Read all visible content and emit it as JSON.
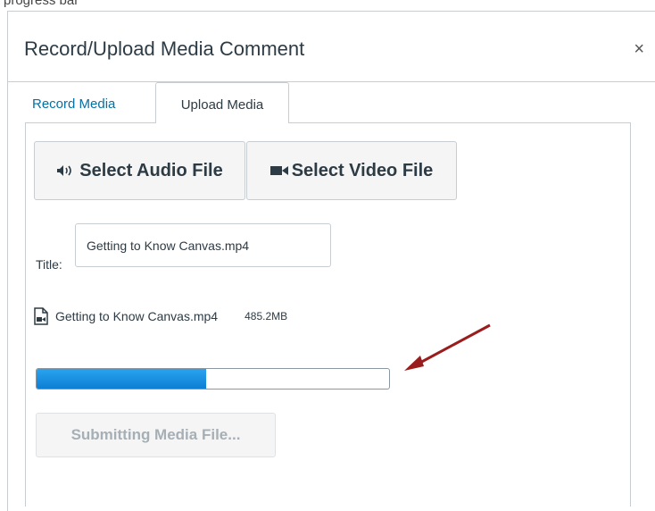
{
  "page_fragment": "progress bar",
  "modal": {
    "title": "Record/Upload Media Comment",
    "close_glyph": "×"
  },
  "tabs": [
    {
      "label": "Record Media",
      "active": false
    },
    {
      "label": "Upload Media",
      "active": true
    }
  ],
  "upload": {
    "audio_button_label": "Select Audio File",
    "audio_icon": "speaker-icon",
    "video_button_label": "Select Video File",
    "video_icon": "video-camera-icon",
    "title_label": "Title:",
    "title_value": "Getting to Know Canvas.mp4",
    "file_icon": "video-file-icon",
    "file_name": "Getting to Know Canvas.mp4",
    "file_size": "485.2MB",
    "progress_fraction": 0.48,
    "submit_label": "Submitting Media File..."
  },
  "colors": {
    "link": "#0770a3",
    "progress": "#1a8fe3",
    "annotation_arrow": "#9b1c1c"
  }
}
